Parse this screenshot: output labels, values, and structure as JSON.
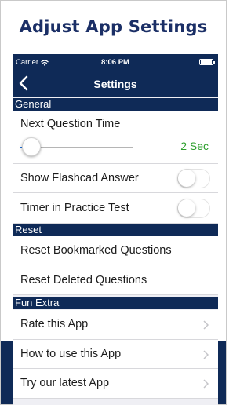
{
  "promo": {
    "title": "Adjust App Settings"
  },
  "status_bar": {
    "carrier": "Carrier",
    "time": "8:06 PM"
  },
  "nav": {
    "title": "Settings",
    "back_icon": "chevron-left-icon"
  },
  "sections": {
    "general": "General",
    "reset": "Reset",
    "fun_extra": "Fun Extra"
  },
  "general": {
    "next_question_time": {
      "label": "Next Question Time",
      "value_text": "2 Sec",
      "slider_fraction": 0.1
    },
    "show_flashcard_answer": {
      "label": "Show Flashcad Answer",
      "on": false
    },
    "timer_in_practice_test": {
      "label": "Timer in Practice Test",
      "on": false
    }
  },
  "reset": {
    "bookmarked": "Reset Bookmarked Questions",
    "deleted": "Reset Deleted Questions"
  },
  "fun_extra": {
    "rate": "Rate this App",
    "how_to": "How to use this App",
    "latest": "Try our latest App"
  },
  "colors": {
    "navy": "#0f2a57",
    "accent_green": "#2a9d2a",
    "slider_blue": "#1e6fd9"
  }
}
